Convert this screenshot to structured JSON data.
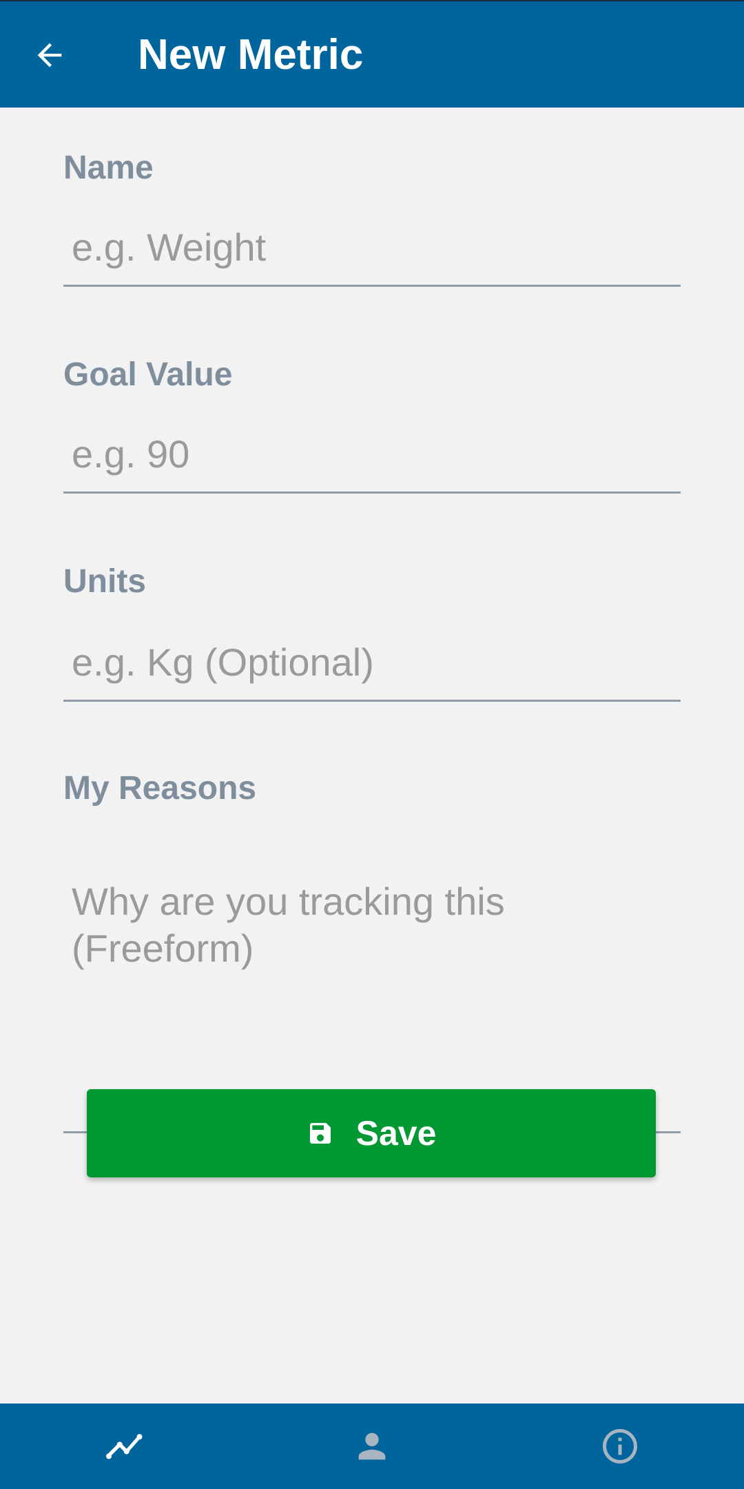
{
  "header": {
    "title": "New Metric",
    "back_icon": "arrow-left-icon",
    "background_color": "#00659c"
  },
  "form": {
    "name": {
      "label": "Name",
      "placeholder": "e.g. Weight",
      "value": ""
    },
    "goal_value": {
      "label": "Goal Value",
      "placeholder": "e.g. 90",
      "value": ""
    },
    "units": {
      "label": "Units",
      "placeholder": "e.g. Kg (Optional)",
      "value": ""
    },
    "reasons": {
      "label": "My Reasons",
      "placeholder": "Why are you tracking this (Freeform)",
      "value": ""
    }
  },
  "save_button": {
    "label": "Save",
    "icon": "floppy-disk-icon",
    "color": "#029934"
  },
  "bottom_nav": {
    "items": [
      {
        "icon": "chart-line-icon",
        "selected": true
      },
      {
        "icon": "person-icon",
        "selected": false
      },
      {
        "icon": "info-icon",
        "selected": false
      }
    ],
    "background_color": "#00659c"
  }
}
